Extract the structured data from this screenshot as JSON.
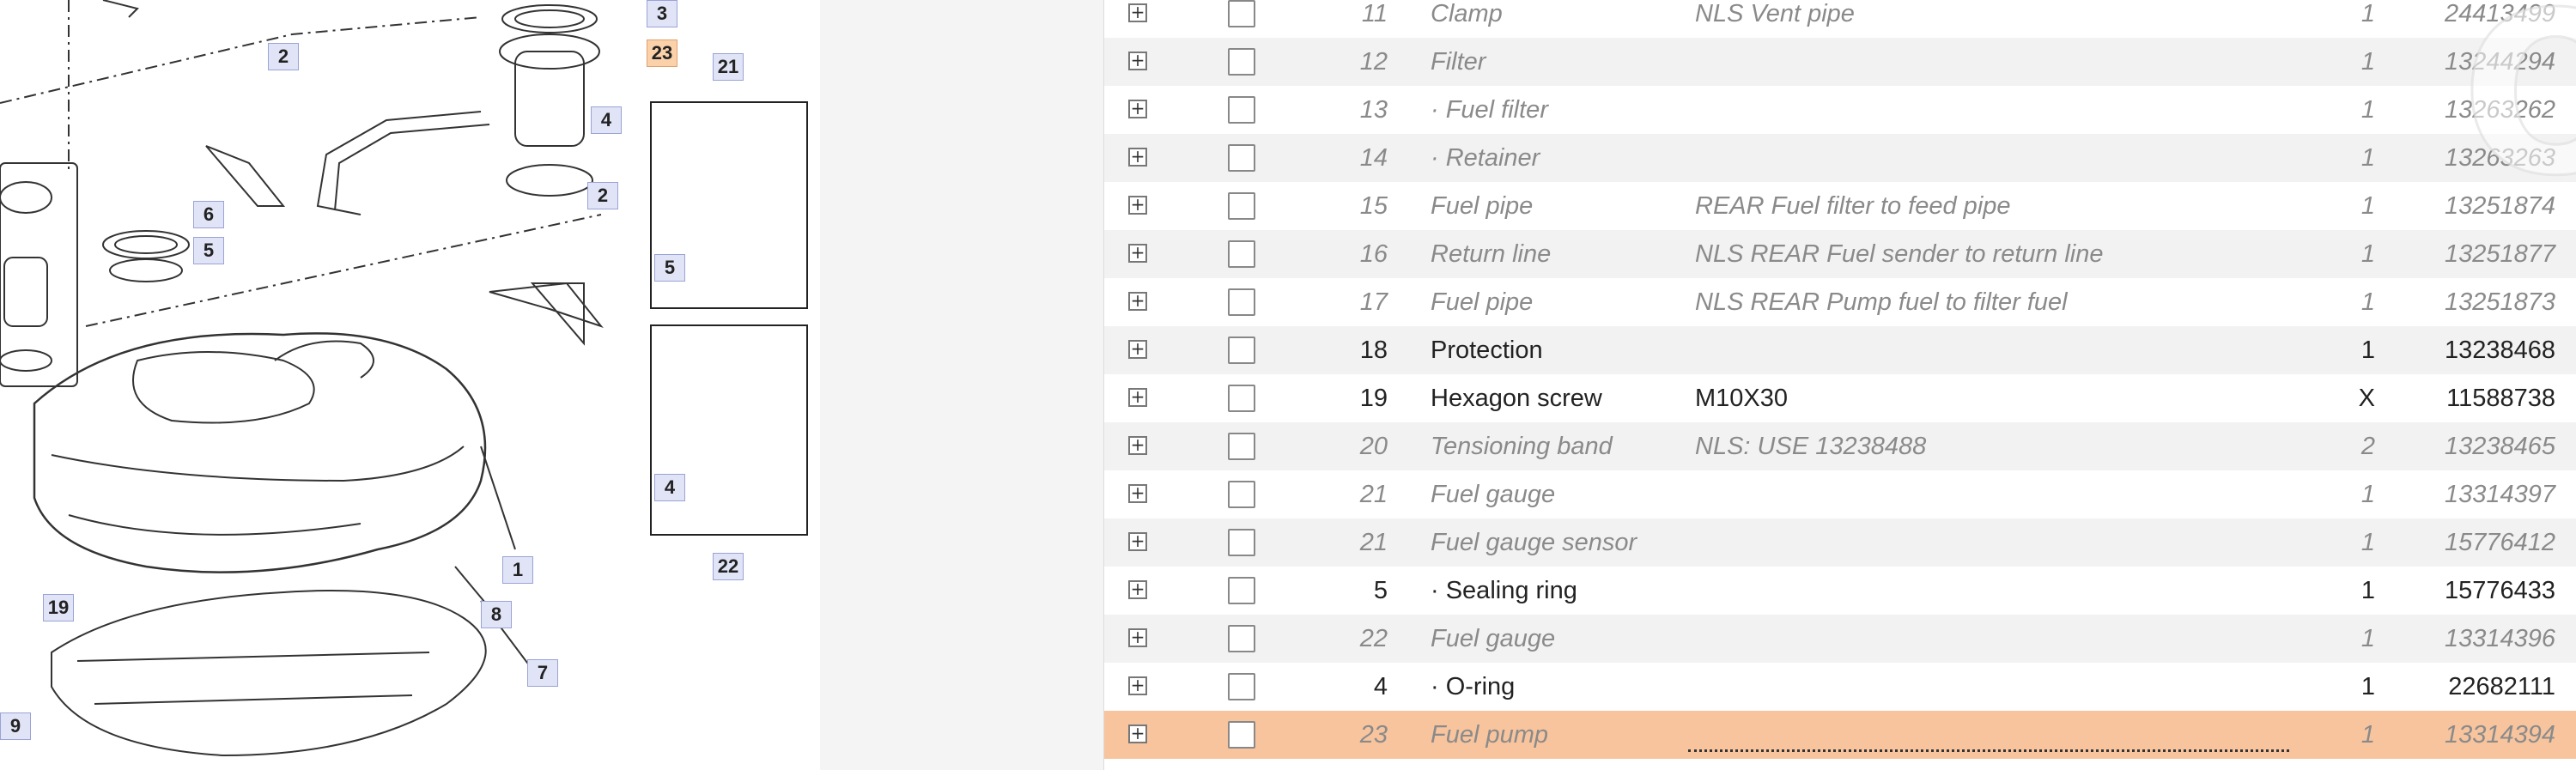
{
  "diagram": {
    "callouts": [
      "3",
      "23",
      "21",
      "2",
      "4",
      "2",
      "6",
      "5",
      "5",
      "1",
      "4",
      "19",
      "8",
      "7",
      "9",
      "22"
    ]
  },
  "parts_table": {
    "rows": [
      {
        "pos": "11",
        "name": "Clamp",
        "note": "NLS Vent pipe",
        "qty": "1",
        "part": "24413499",
        "style": "old"
      },
      {
        "pos": "12",
        "name": "Filter",
        "note": "",
        "qty": "1",
        "part": "13244294",
        "style": "old"
      },
      {
        "pos": "13",
        "name": "· Fuel filter",
        "note": "",
        "qty": "1",
        "part": "13263262",
        "style": "old"
      },
      {
        "pos": "14",
        "name": "· Retainer",
        "note": "",
        "qty": "1",
        "part": "13263263",
        "style": "old"
      },
      {
        "pos": "15",
        "name": "Fuel pipe",
        "note": "REAR Fuel filter to feed pipe",
        "qty": "1",
        "part": "13251874",
        "style": "old"
      },
      {
        "pos": "16",
        "name": "Return line",
        "note": "NLS REAR Fuel sender to return line",
        "qty": "1",
        "part": "13251877",
        "style": "old"
      },
      {
        "pos": "17",
        "name": "Fuel pipe",
        "note": "NLS REAR Pump fuel to filter fuel",
        "qty": "1",
        "part": "13251873",
        "style": "old"
      },
      {
        "pos": "18",
        "name": "Protection",
        "note": "",
        "qty": "1",
        "part": "13238468",
        "style": "normal"
      },
      {
        "pos": "19",
        "name": "Hexagon screw",
        "note": "M10X30",
        "qty": "X",
        "part": "11588738",
        "style": "normal"
      },
      {
        "pos": "20",
        "name": "Tensioning band",
        "note": "NLS: USE 13238488",
        "qty": "2",
        "part": "13238465",
        "style": "old"
      },
      {
        "pos": "21",
        "name": "Fuel gauge",
        "note": "",
        "qty": "1",
        "part": "13314397",
        "style": "old"
      },
      {
        "pos": "21",
        "name": "Fuel gauge sensor",
        "note": "",
        "qty": "1",
        "part": "15776412",
        "style": "old"
      },
      {
        "pos": "5",
        "name": "· Sealing ring",
        "note": "",
        "qty": "1",
        "part": "15776433",
        "style": "normal"
      },
      {
        "pos": "22",
        "name": "Fuel gauge",
        "note": "",
        "qty": "1",
        "part": "13314396",
        "style": "old"
      },
      {
        "pos": "4",
        "name": "· O-ring",
        "note": "",
        "qty": "1",
        "part": "22682111",
        "style": "normal"
      },
      {
        "pos": "23",
        "name": "Fuel pump",
        "note": "",
        "qty": "1",
        "part": "13314394",
        "style": "highlight"
      }
    ]
  },
  "watermark": "OVOKO"
}
